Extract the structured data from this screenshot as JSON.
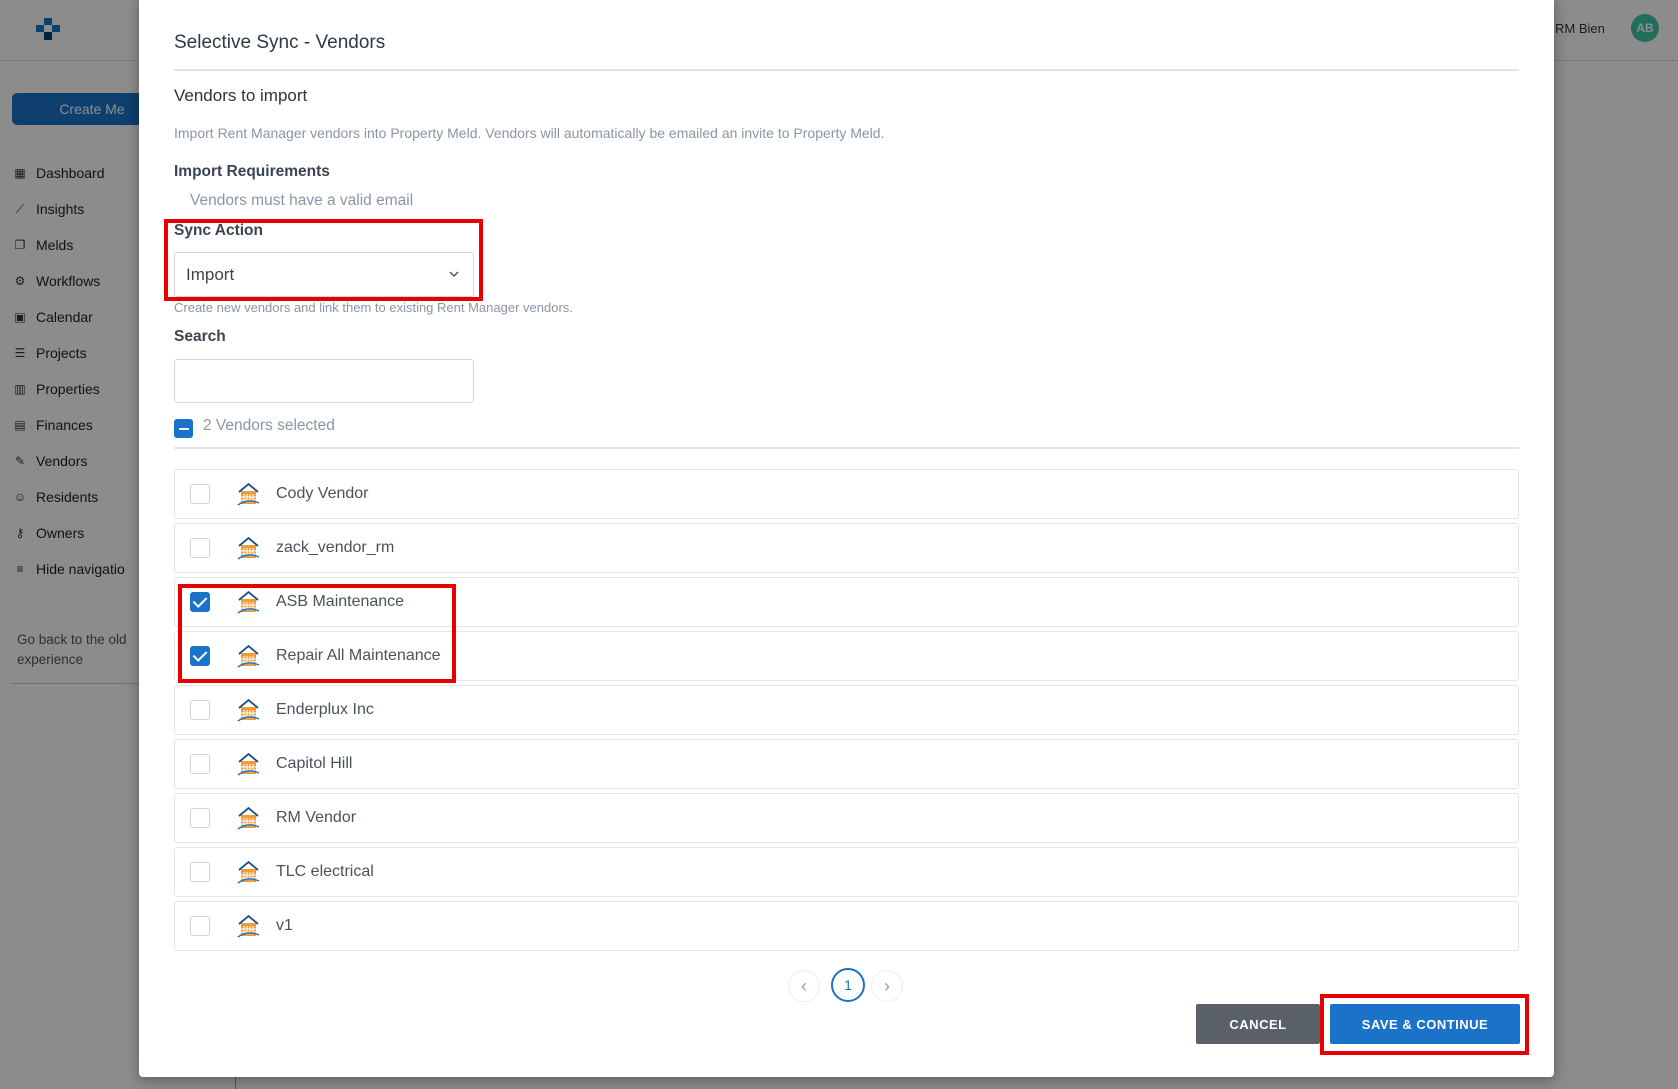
{
  "app": {
    "user_name": "RM Bien",
    "avatar_initials": "AB",
    "create_button": "Create Me",
    "nav": [
      {
        "label": "Dashboard",
        "icon": "dashboard-icon"
      },
      {
        "label": "Insights",
        "icon": "chart-line-icon"
      },
      {
        "label": "Melds",
        "icon": "copy-icon"
      },
      {
        "label": "Workflows",
        "icon": "gears-icon"
      },
      {
        "label": "Calendar",
        "icon": "calendar-icon"
      },
      {
        "label": "Projects",
        "icon": "list-icon"
      },
      {
        "label": "Properties",
        "icon": "building-icon"
      },
      {
        "label": "Finances",
        "icon": "calculator-icon"
      },
      {
        "label": "Vendors",
        "icon": "wrench-icon"
      },
      {
        "label": "Residents",
        "icon": "users-icon"
      },
      {
        "label": "Owners",
        "icon": "key-icon"
      },
      {
        "label": "Hide navigatio",
        "icon": "collapse-icon"
      }
    ],
    "old_experience": "Go back to the old experience"
  },
  "modal": {
    "title": "Selective Sync - Vendors",
    "subtitle": "Vendors to import",
    "description": "Import Rent Manager vendors into Property Meld. Vendors will automatically be emailed an invite to Property Meld.",
    "requirements_label": "Import Requirements",
    "requirement_item": "Vendors must have a valid email",
    "sync_action_label": "Sync Action",
    "sync_action_value": "Import",
    "sync_action_hint": "Create new vendors and link them to existing Rent Manager vendors.",
    "search_label": "Search",
    "search_value": "",
    "selected_count": "2 Vendors selected",
    "vendors": [
      {
        "name": "Cody Vendor",
        "checked": false
      },
      {
        "name": "zack_vendor_rm",
        "checked": false
      },
      {
        "name": "ASB Maintenance",
        "checked": true
      },
      {
        "name": "Repair All Maintenance",
        "checked": true
      },
      {
        "name": "Enderplux Inc",
        "checked": false
      },
      {
        "name": "Capitol Hill",
        "checked": false
      },
      {
        "name": "RM Vendor",
        "checked": false
      },
      {
        "name": "TLC electrical",
        "checked": false
      },
      {
        "name": "v1",
        "checked": false
      }
    ],
    "pagination": {
      "prev": "‹",
      "current_page": "1",
      "next": "›"
    },
    "cancel_label": "CANCEL",
    "save_label": "SAVE & CONTINUE"
  },
  "colors": {
    "accent": "#1a73c9",
    "highlight": "#e60000",
    "cancel_button": "#5a6068",
    "avatar": "#3ec6a8"
  }
}
